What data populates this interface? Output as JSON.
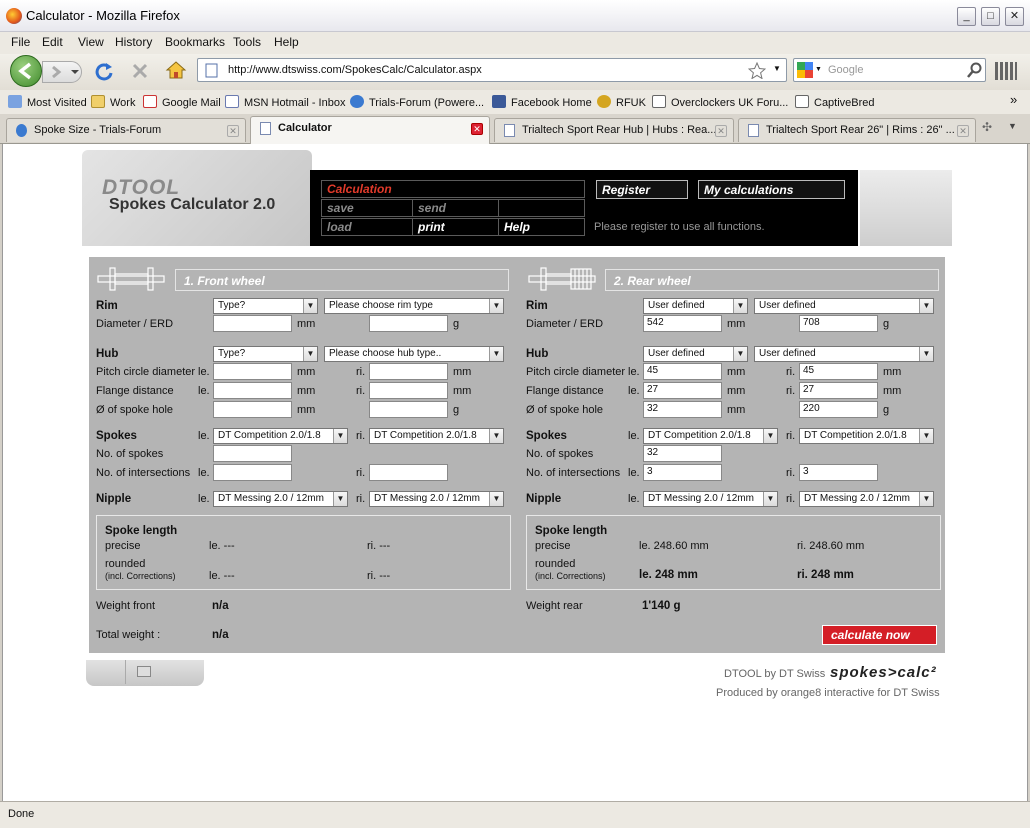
{
  "window": {
    "title": "Calculator - Mozilla Firefox",
    "min": "_",
    "max": "□",
    "close": "✕"
  },
  "menu": [
    "File",
    "Edit",
    "View",
    "History",
    "Bookmarks",
    "Tools",
    "Help"
  ],
  "nav": {
    "url": "http://www.dtswiss.com/SpokesCalc/Calculator.aspx",
    "search_placeholder": "Google"
  },
  "bookmarks": [
    "Most Visited",
    "Work",
    "Google Mail",
    "MSN Hotmail - Inbox",
    "Trials-Forum (Powere...",
    "Facebook  Home",
    "RFUK",
    "Overclockers UK Foru...",
    "CaptiveBred"
  ],
  "bookmarks_more": "»",
  "tabs": [
    "Spoke Size - Trials-Forum",
    "Calculator",
    "Trialtech Sport Rear Hub | Hubs : Rea...",
    "Trialtech Sport Rear 26\" | Rims : 26\" ..."
  ],
  "status": "Done",
  "brand": {
    "dtool": "DTOOL",
    "title": "Spokes Calculator 2.0"
  },
  "toolbar": {
    "calculation": "Calculation",
    "save": "save",
    "send": "send",
    "load": "load",
    "print": "print",
    "help": "Help",
    "register": "Register",
    "my_calculations": "My calculations",
    "register_note": "Please register to use all functions."
  },
  "labels": {
    "rim": "Rim",
    "diameter": "Diameter / ERD",
    "hub": "Hub",
    "pcd": "Pitch circle diameter",
    "flange": "Flange distance",
    "hole": "Ø of spoke hole",
    "spokes": "Spokes",
    "num_spokes": "No. of spokes",
    "intersections": "No. of intersections",
    "nipple": "Nipple",
    "le": "le.",
    "ri": "ri.",
    "mm": "mm",
    "g": "g",
    "spoke_length": "Spoke length",
    "precise": "precise",
    "rounded": "rounded",
    "incl": "(incl. Corrections)"
  },
  "front": {
    "title": "1. Front wheel",
    "rim_type": "Type?",
    "rim_choice": "Please choose rim type",
    "diameter": "",
    "rim_weight": "",
    "hub_type": "Type?",
    "hub_choice": "Please choose hub type..",
    "pcd_le": "",
    "pcd_ri": "",
    "flange_le": "",
    "flange_ri": "",
    "hole": "",
    "hub_weight": "",
    "spoke_le": "DT Competition 2.0/1.8",
    "spoke_ri": "DT Competition 2.0/1.8",
    "num_spokes": "",
    "cross_le": "",
    "cross_ri": "",
    "nipple_le": "DT Messing 2.0 / 12mm",
    "nipple_ri": "DT Messing 2.0 / 12mm",
    "precise_le": "le. ---",
    "precise_ri": "ri. ---",
    "rounded_le": "le. ---",
    "rounded_ri": "ri. ---",
    "weight_label": "Weight front",
    "weight": "n/a"
  },
  "rear": {
    "title": "2. Rear wheel",
    "rim_type": "User defined",
    "rim_choice": "User defined",
    "diameter": "542",
    "rim_weight": "708",
    "hub_type": "User defined",
    "hub_choice": "User defined",
    "pcd_le": "45",
    "pcd_ri": "45",
    "flange_le": "27",
    "flange_ri": "27",
    "hole": "32",
    "hub_weight": "220",
    "spoke_le": "DT Competition 2.0/1.8",
    "spoke_ri": "DT Competition 2.0/1.8",
    "num_spokes": "32",
    "cross_le": "3",
    "cross_ri": "3",
    "nipple_le": "DT Messing 2.0 / 12mm",
    "nipple_ri": "DT Messing 2.0 / 12mm",
    "precise_le": "le. 248.60 mm",
    "precise_ri": "ri. 248.60 mm",
    "rounded_le": "le. 248 mm",
    "rounded_ri": "ri. 248 mm",
    "weight_label": "Weight rear",
    "weight": "1'140 g"
  },
  "total": {
    "label": "Total weight :",
    "value": "n/a"
  },
  "calculate": "calculate now",
  "footer": {
    "by": "DTOOL by DT Swiss",
    "logo": "spokes>calc²",
    "produced": "Produced by orange8 interactive for DT Swiss"
  },
  "colors": {
    "accent": "#d41e26",
    "panel": "#b4b4b4"
  }
}
